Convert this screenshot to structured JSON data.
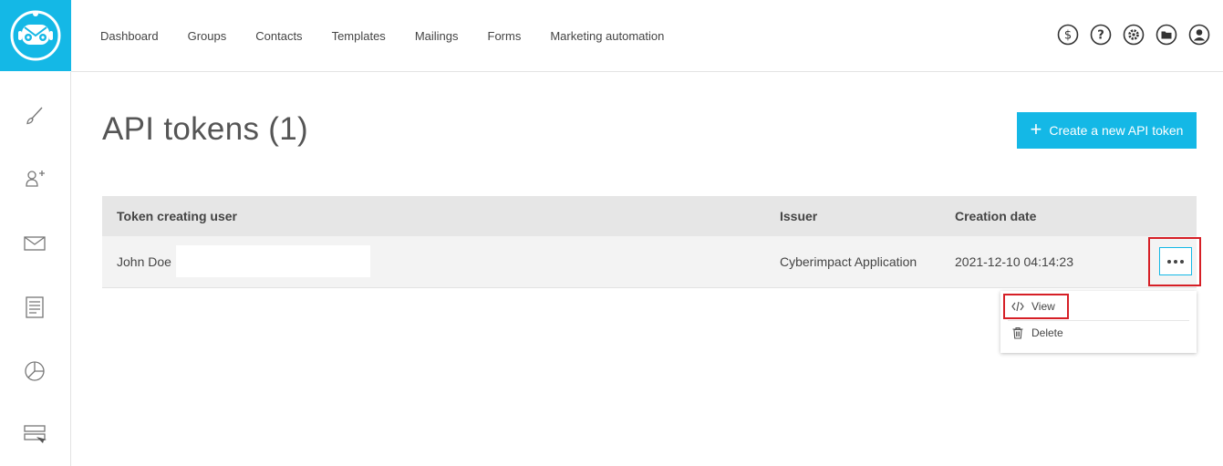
{
  "nav": {
    "items": [
      "Dashboard",
      "Groups",
      "Contacts",
      "Templates",
      "Mailings",
      "Forms",
      "Marketing automation"
    ]
  },
  "top_icons": [
    "dollar-icon",
    "help-icon",
    "gear-icon",
    "folder-icon",
    "user-icon"
  ],
  "sidebar": {
    "items": [
      "brush-icon",
      "add-contact-icon",
      "mail-icon",
      "template-icon",
      "report-icon",
      "form-icon"
    ]
  },
  "page": {
    "title": "API tokens (1)",
    "create_label": "Create a new API token"
  },
  "table": {
    "headers": {
      "user": "Token creating user",
      "issuer": "Issuer",
      "date": "Creation date"
    },
    "rows": [
      {
        "user": "John Doe",
        "issuer": "Cyberimpact Application",
        "date": "2021-12-10 04:14:23"
      }
    ]
  },
  "menu": {
    "view_label": "View",
    "delete_label": "Delete"
  },
  "colors": {
    "accent": "#14b8e6",
    "highlight": "#d61f26"
  }
}
